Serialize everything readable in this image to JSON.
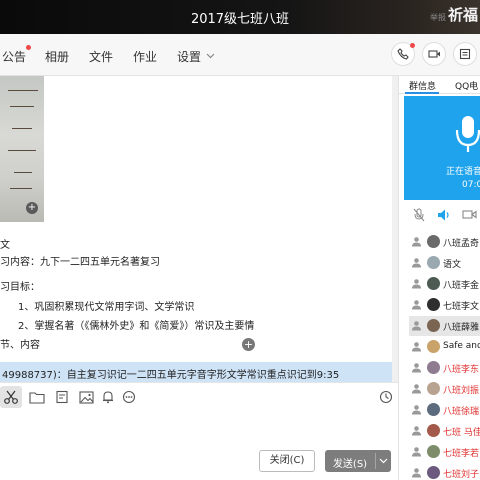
{
  "window": {
    "title": "2017级七班八班",
    "report_label": "举报",
    "blessing_label": "祈福"
  },
  "nav": {
    "items": [
      "公告",
      "相册",
      "文件",
      "作业",
      "设置"
    ],
    "settings_chevron": "chevron-down-icon"
  },
  "chat": {
    "lines": [
      "文",
      "习内容：九下一二四五单元名著复习",
      "习目标：",
      "1、巩固积累现代文常用字词、文学常识",
      "2、掌握名著（《儒林外史》和《简爱》）常识及主要情",
      "节、内容"
    ],
    "highlight_message": "49988737)：自主复习识记一二四五单元字音字形文学常识重点识记到9:35"
  },
  "buttons": {
    "close": "关闭(C)",
    "send": "发送(S)"
  },
  "right_panel": {
    "tabs": [
      "群信息",
      "QQ电"
    ],
    "voice_status": "正在语音",
    "voice_timer": "07:0",
    "members": [
      {
        "name": "八班孟奇",
        "red": false,
        "selected": false
      },
      {
        "name": "语文",
        "red": false,
        "selected": false
      },
      {
        "name": "八班李金",
        "red": false,
        "selected": false
      },
      {
        "name": "七班李文",
        "red": false,
        "selected": false
      },
      {
        "name": "八班薛雅",
        "red": false,
        "selected": true
      },
      {
        "name": "Safe and",
        "red": false,
        "selected": false
      },
      {
        "name": "八班李东",
        "red": true,
        "selected": false
      },
      {
        "name": "八班刘振",
        "red": true,
        "selected": false
      },
      {
        "name": "八班徐瑞",
        "red": true,
        "selected": false
      },
      {
        "name": "七班 马佳",
        "red": true,
        "selected": false
      },
      {
        "name": "七班李若",
        "red": true,
        "selected": false
      },
      {
        "name": "七班刘子",
        "red": true,
        "selected": false
      }
    ]
  },
  "colors": {
    "accent": "#1ea3ec",
    "highlight": "#cfe3f7",
    "send_button": "#7d7d7d",
    "red_name": "#e0302f",
    "notify_dot": "#f04848"
  }
}
